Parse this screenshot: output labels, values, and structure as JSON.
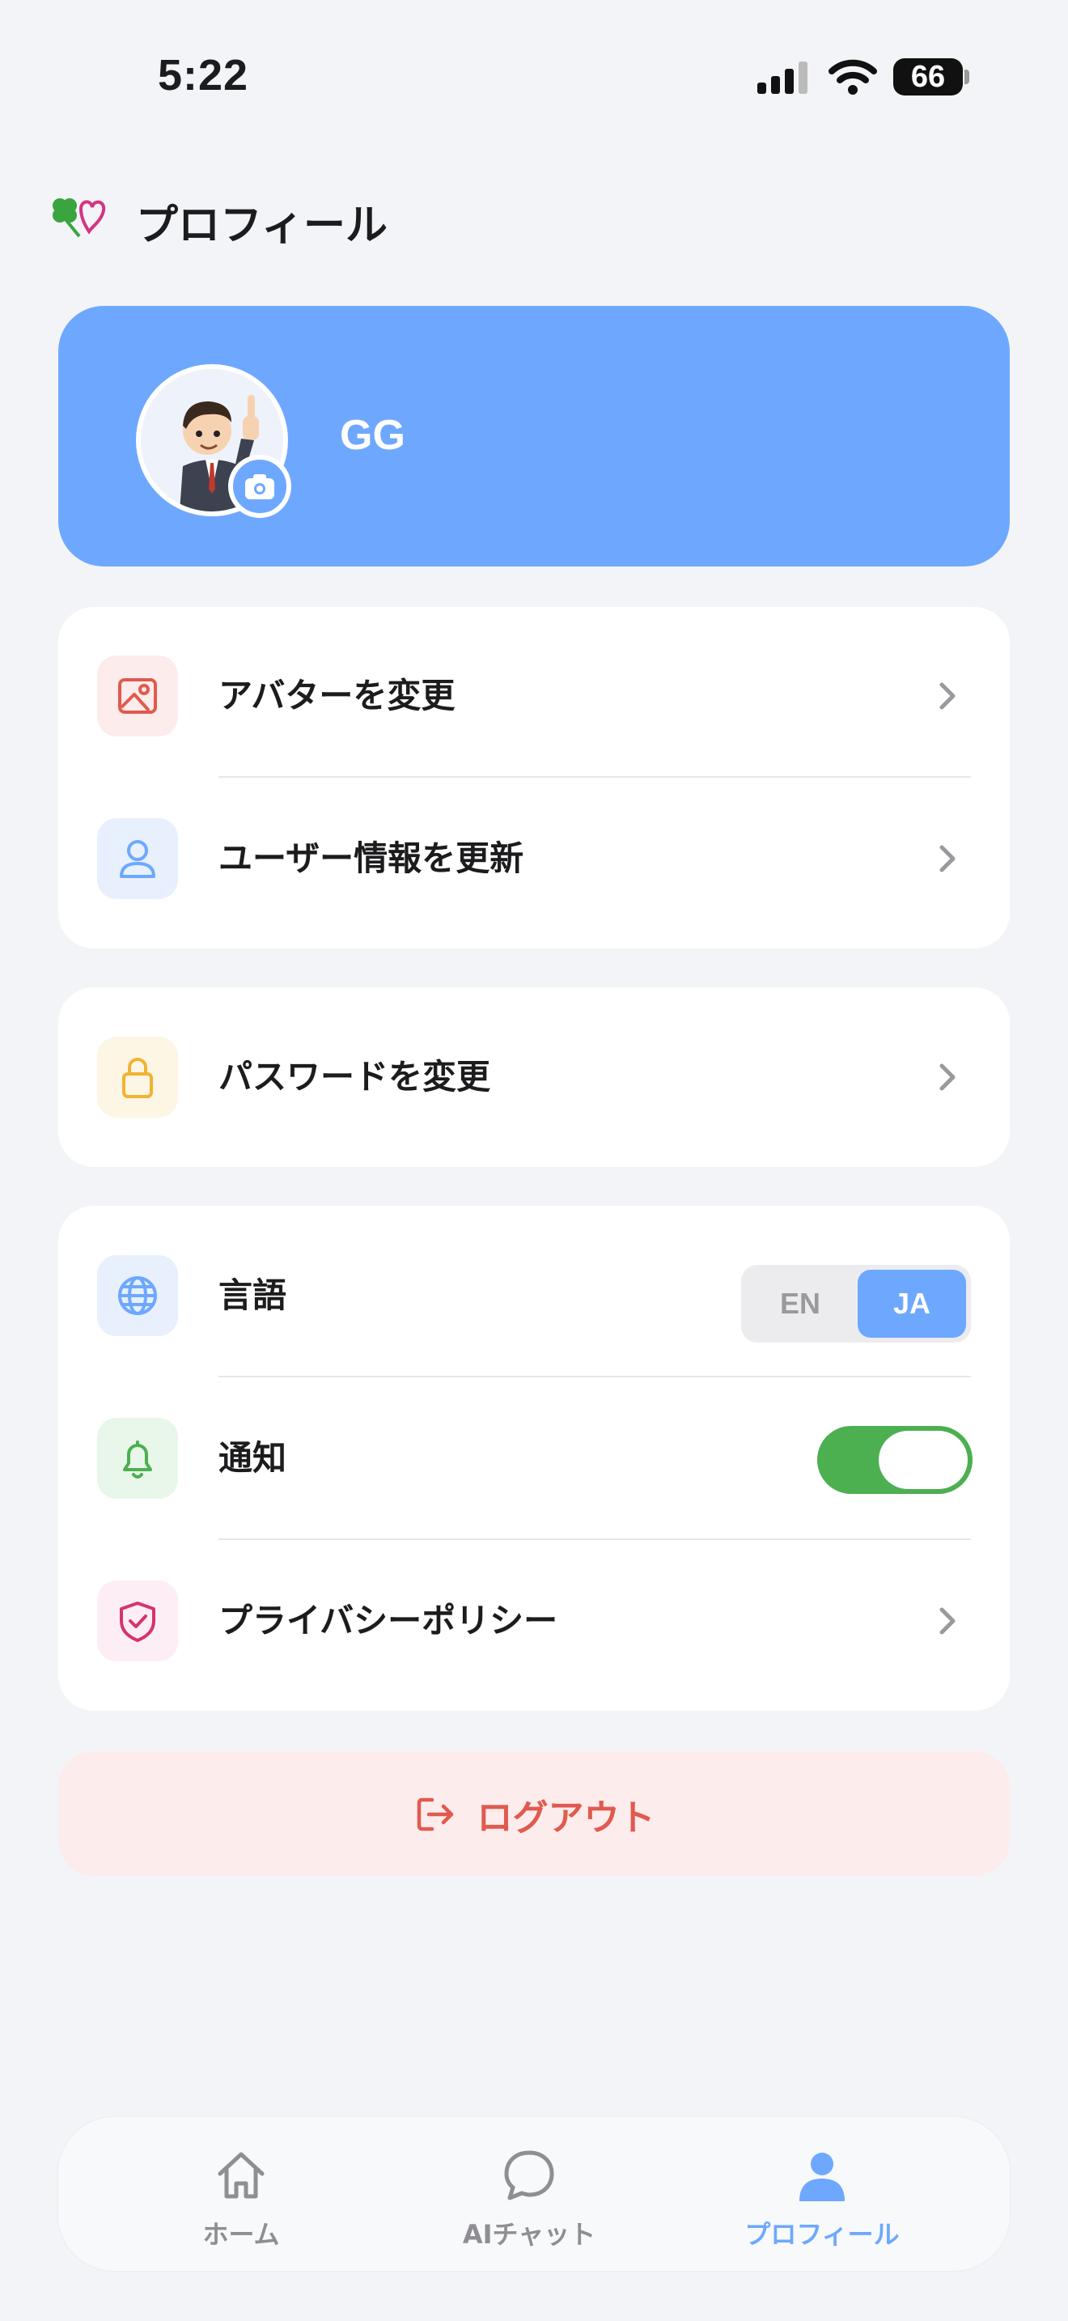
{
  "status_bar": {
    "time": "5:22",
    "battery": "66"
  },
  "header": {
    "title": "プロフィール",
    "logo_icon": "clover-heart-icon"
  },
  "profile": {
    "name": "GG",
    "avatar_icon": "cartoon-businessman-avatar",
    "badge_icon": "camera-icon"
  },
  "menu_group_1": [
    {
      "label": "アバターを変更",
      "icon": "image-icon",
      "color": "#e05a4f"
    },
    {
      "label": "ユーザー情報を更新",
      "icon": "user-icon",
      "color": "#6ea8fe"
    }
  ],
  "menu_group_2": [
    {
      "label": "パスワードを変更",
      "icon": "lock-icon",
      "color": "#f2b233"
    }
  ],
  "settings": {
    "language": {
      "label": "言語",
      "options": [
        "EN",
        "JA"
      ],
      "selected": "JA"
    },
    "notifications": {
      "label": "通知",
      "enabled": true
    },
    "privacy": {
      "label": "プライバシーポリシー"
    }
  },
  "logout": {
    "label": "ログアウト"
  },
  "tabs": [
    {
      "label": "ホーム",
      "icon": "home-icon",
      "active": false
    },
    {
      "label": "AIチャット",
      "icon": "chat-bubble-icon",
      "active": false
    },
    {
      "label": "プロフィール",
      "icon": "person-icon",
      "active": true
    }
  ],
  "colors": {
    "accent": "#6ea8fe",
    "background": "#f3f4f8",
    "danger": "#e05a4f",
    "success": "#4caf50"
  }
}
